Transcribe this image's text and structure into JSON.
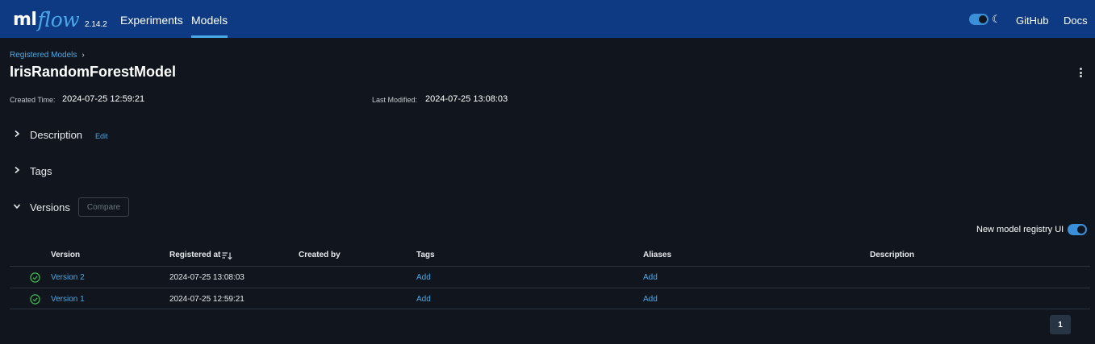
{
  "header": {
    "logo_ml": "ml",
    "logo_flow": "flow",
    "version": "2.14.2",
    "nav": [
      {
        "label": "Experiments",
        "active": false
      },
      {
        "label": "Models",
        "active": true
      }
    ],
    "theme_toggle_icon": "moon-icon",
    "links": [
      "GitHub",
      "Docs"
    ]
  },
  "breadcrumb": {
    "items": [
      "Registered Models"
    ],
    "separator": "›"
  },
  "model": {
    "name": "IrisRandomForestModel",
    "created_label": "Created Time:",
    "created_value": "2024-07-25 12:59:21",
    "modified_label": "Last Modified:",
    "modified_value": "2024-07-25 13:08:03"
  },
  "sections": {
    "description": {
      "title": "Description",
      "edit_label": "Edit",
      "expanded": false
    },
    "tags": {
      "title": "Tags",
      "expanded": false
    },
    "versions": {
      "title": "Versions",
      "compare_label": "Compare",
      "expanded": true
    }
  },
  "registry_toggle": {
    "label": "New model registry UI",
    "on": true
  },
  "table": {
    "columns": [
      "Version",
      "Registered at",
      "Created by",
      "Tags",
      "Aliases",
      "Description"
    ],
    "rows": [
      {
        "version": "Version 2",
        "registered_at": "2024-07-25 13:08:03",
        "created_by": "",
        "tags": "Add",
        "aliases": "Add",
        "description": ""
      },
      {
        "version": "Version 1",
        "registered_at": "2024-07-25 12:59:21",
        "created_by": "",
        "tags": "Add",
        "aliases": "Add",
        "description": ""
      }
    ]
  },
  "pagination": {
    "current": "1"
  },
  "colors": {
    "header_bg": "#0d3a82",
    "page_bg": "#11161e",
    "accent": "#4aa8e8",
    "status_ready": "#3fb950"
  }
}
